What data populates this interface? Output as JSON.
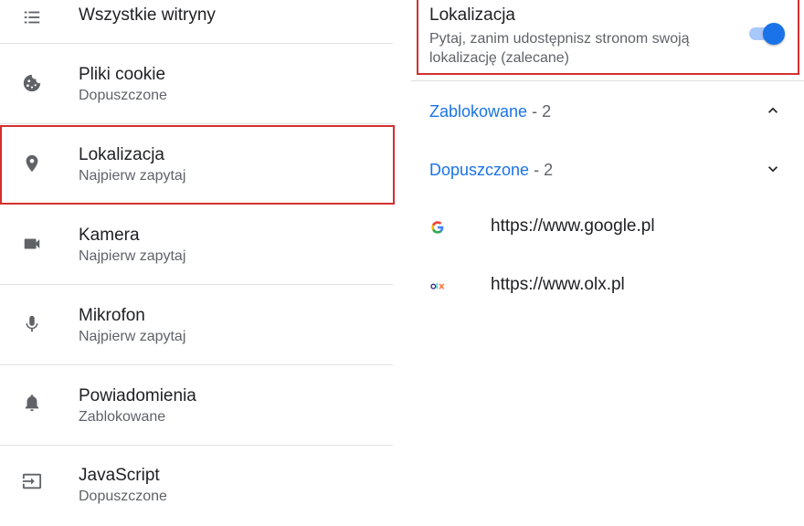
{
  "left_list": {
    "items": [
      {
        "title": "Wszystkie witryny",
        "subtitle": "",
        "icon": "list-icon"
      },
      {
        "title": "Pliki cookie",
        "subtitle": "Dopuszczone",
        "icon": "cookie-icon"
      },
      {
        "title": "Lokalizacja",
        "subtitle": "Najpierw zapytaj",
        "icon": "location-pin-icon"
      },
      {
        "title": "Kamera",
        "subtitle": "Najpierw zapytaj",
        "icon": "video-camera-icon"
      },
      {
        "title": "Mikrofon",
        "subtitle": "Najpierw zapytaj",
        "icon": "microphone-icon"
      },
      {
        "title": "Powiadomienia",
        "subtitle": "Zablokowane",
        "icon": "bell-icon"
      },
      {
        "title": "JavaScript",
        "subtitle": "Dopuszczone",
        "icon": "javascript-icon"
      }
    ]
  },
  "location_setting": {
    "title": "Lokalizacja",
    "description": "Pytaj, zanim udostępnisz stronom swoją lokalizację (zalecane)",
    "toggle_on": true
  },
  "groups": [
    {
      "label": "Zablokowane",
      "count": " - 2",
      "expanded": true
    },
    {
      "label": "Dopuszczone",
      "count": " - 2",
      "expanded": false
    }
  ],
  "sites": [
    {
      "url": "https://www.google.pl",
      "icon": "google-favicon-icon"
    },
    {
      "url": "https://www.olx.pl",
      "icon": "olx-favicon-icon"
    }
  ],
  "colors": {
    "accent": "#1a73e8",
    "highlight": "#d32f2f",
    "icon": "#5f6368",
    "divider": "#e0e0e0"
  }
}
